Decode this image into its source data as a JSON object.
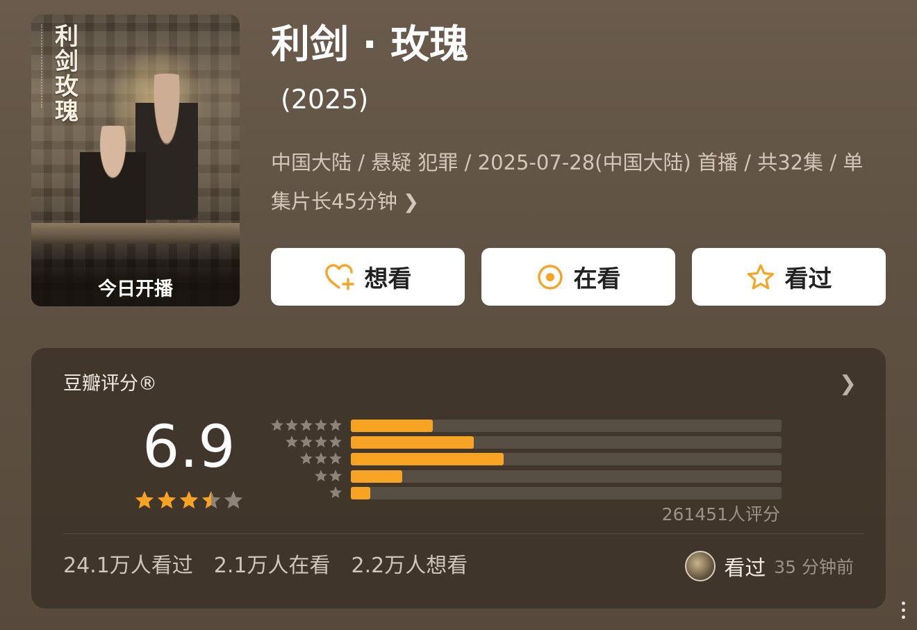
{
  "poster": {
    "calligraphy": [
      "利",
      "剑",
      "玫",
      "瑰"
    ],
    "badge": "今日开播"
  },
  "header": {
    "title": "利剑 · 玫瑰",
    "year": "(2025)",
    "meta": "中国大陆 / 悬疑 犯罪 / 2025-07-28(中国大陆) 首播 / 共32集 / 单集片长45分钟"
  },
  "actions": {
    "want": "想看",
    "watching": "在看",
    "watched": "看过"
  },
  "rating": {
    "label": "豆瓣评分®",
    "score": "6.9",
    "score_stars": 3.5,
    "distribution": [
      {
        "stars": 5,
        "fraction": 0.19
      },
      {
        "stars": 4,
        "fraction": 0.285
      },
      {
        "stars": 3,
        "fraction": 0.355
      },
      {
        "stars": 2,
        "fraction": 0.12
      },
      {
        "stars": 1,
        "fraction": 0.045
      }
    ],
    "count": "261451人评分"
  },
  "stats": {
    "watched": "24.1万人看过",
    "watching": "2.1万人在看",
    "want": "2.2万人想看"
  },
  "recent": {
    "action": "看过",
    "time": "35 分钟前"
  },
  "colors": {
    "accent": "#f7a324",
    "background": "#5e5142",
    "card": "#382f25"
  }
}
